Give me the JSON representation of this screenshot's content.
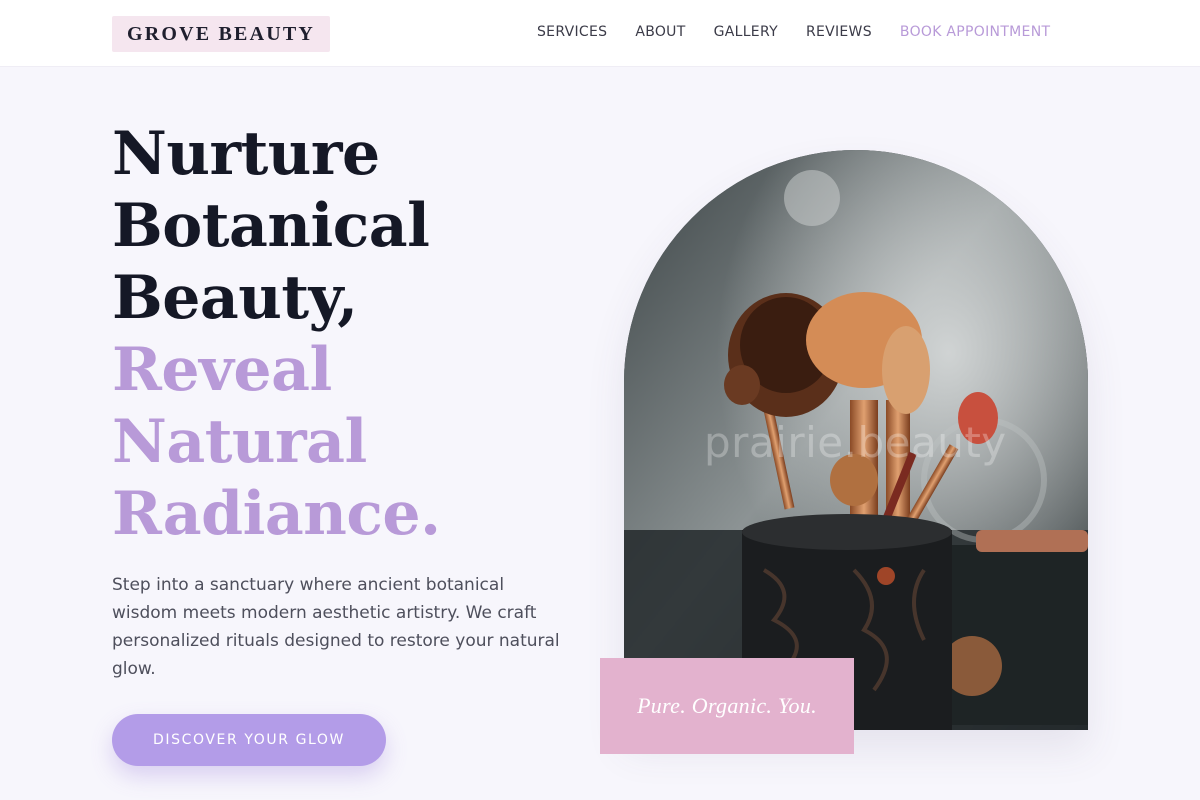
{
  "brand": {
    "logo_text": "GROVE BEAUTY",
    "accent_color": "#b89ad8"
  },
  "nav": {
    "items": [
      {
        "label": "SERVICES"
      },
      {
        "label": "ABOUT"
      },
      {
        "label": "GALLERY"
      },
      {
        "label": "REVIEWS"
      }
    ],
    "cta_label": "BOOK APPOINTMENT"
  },
  "hero": {
    "headline_dark": [
      "Nurture",
      "Botanical",
      "Beauty,"
    ],
    "headline_accent": [
      "Reveal",
      "Natural",
      "Radiance."
    ],
    "lead": "Step into a sanctuary where ancient botanical wisdom meets modern aesthetic artistry. We craft personalized rituals designed to restore your natural glow.",
    "button_label": "DISCOVER YOUR GLOW",
    "image_watermark": "prairie.beauty",
    "tagline": "Pure. Organic. You."
  }
}
